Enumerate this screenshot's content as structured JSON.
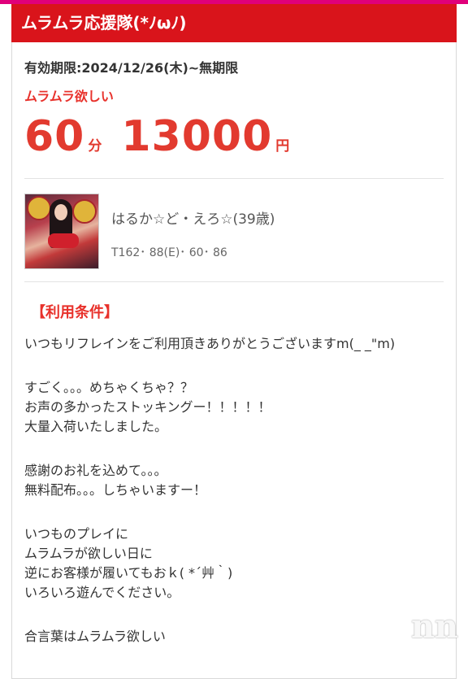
{
  "header": {
    "title": "ムラムラ応援隊(*ﾉωﾉ)"
  },
  "coupon": {
    "validity": "有効期限:2024/12/26(木)~無期限",
    "plan_name": "ムラムラ欲しい",
    "duration_value": "60",
    "duration_unit": "分",
    "price_value": "13000",
    "price_unit": "円"
  },
  "cast": {
    "name": "はるか☆ど・えろ☆(39歳)",
    "stats": "T162･ 88(E)･ 60･ 86"
  },
  "terms": {
    "title": "【利用条件】",
    "lines": [
      "いつもリフレインをご利用頂きありがとうございますm(_ _\"m)",
      "",
      "すごく。。。めちゃくちゃ？？",
      "お声の多かったストッキングー！！！！！",
      "大量入荷いたしました。",
      "",
      "感謝のお礼を込めて。。。",
      "無料配布。。。しちゃいますー！",
      "",
      "いつものプレイに",
      "ムラムラが欲しい日に",
      "逆にお客様が履いてもおｋ( *´艸｀)",
      "いろいろ遊んでください。",
      "",
      "合言葉はムラムラ欲しい"
    ]
  },
  "colors": {
    "accent": "#d9141b",
    "price": "#e23a2f",
    "strip": "#e0007a"
  }
}
